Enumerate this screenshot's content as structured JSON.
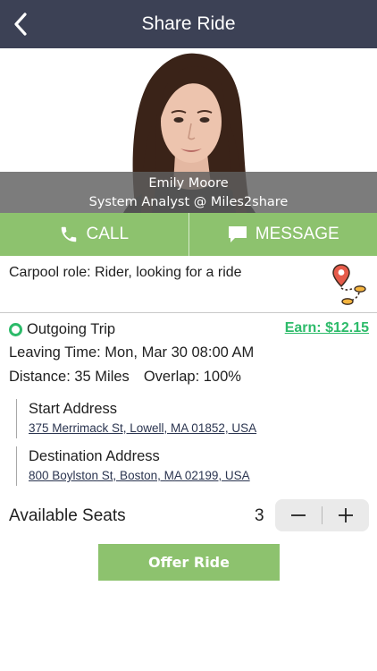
{
  "header": {
    "title": "Share Ride",
    "back_icon": "chevron-left-icon"
  },
  "profile": {
    "name": "Emily Moore",
    "role": "System Analyst @ Miles2share"
  },
  "actions": {
    "call_label": "CALL",
    "message_label": "MESSAGE",
    "call_icon": "phone-icon",
    "message_icon": "chat-bubble-icon"
  },
  "carpool": {
    "role_text": "Carpool role: Rider, looking for a ride",
    "route_icon": "route-map-icon"
  },
  "trip": {
    "type": "Outgoing Trip",
    "earn": "Earn: $12.15",
    "leaving": "Leaving Time: Mon, Mar 30 08:00 AM",
    "distance": "Distance: 35 Miles",
    "overlap": "Overlap: 100%"
  },
  "start": {
    "label": "Start Address",
    "address": "375 Merrimack St, Lowell, MA 01852, USA"
  },
  "destination": {
    "label": "Destination Address",
    "address": "800 Boylston St, Boston, MA 02199, USA"
  },
  "seats": {
    "label": "Available Seats",
    "count": "3"
  },
  "offer_button": {
    "label": "Offer Ride"
  },
  "colors": {
    "header": "#3c4155",
    "accent_green": "#8dc26e",
    "earn_green": "#2dbb6a",
    "link": "#2b3550"
  }
}
